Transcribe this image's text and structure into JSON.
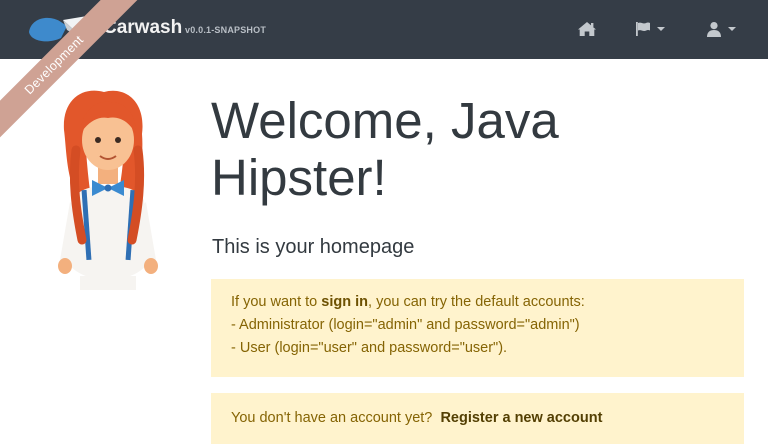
{
  "navbar": {
    "app_name": "Carwash",
    "version": "v0.0.1-SNAPSHOT",
    "items": [
      {
        "icon": "home-icon"
      },
      {
        "icon": "flag-icon",
        "has_dropdown": true
      },
      {
        "icon": "user-icon",
        "has_dropdown": true
      }
    ]
  },
  "ribbon": {
    "label": "Development"
  },
  "main": {
    "title": "Welcome, Java Hipster!",
    "subtitle": "This is your homepage",
    "accounts_alert": {
      "intro_prefix": "If you want to ",
      "sign_in_link": "sign in",
      "intro_suffix": ", you can try the default accounts:",
      "admin_line": "- Administrator (login=\"admin\" and password=\"admin\")",
      "user_line": "- User (login=\"user\" and password=\"user\")."
    },
    "register_alert": {
      "text": "You don't have an account yet?",
      "register_link": "Register a new account"
    }
  },
  "colors": {
    "navbar_bg": "#353d47",
    "ribbon_bg": "#cfa294",
    "alert_bg": "#fff3cd",
    "alert_text": "#856404",
    "heading_text": "#333a40"
  }
}
